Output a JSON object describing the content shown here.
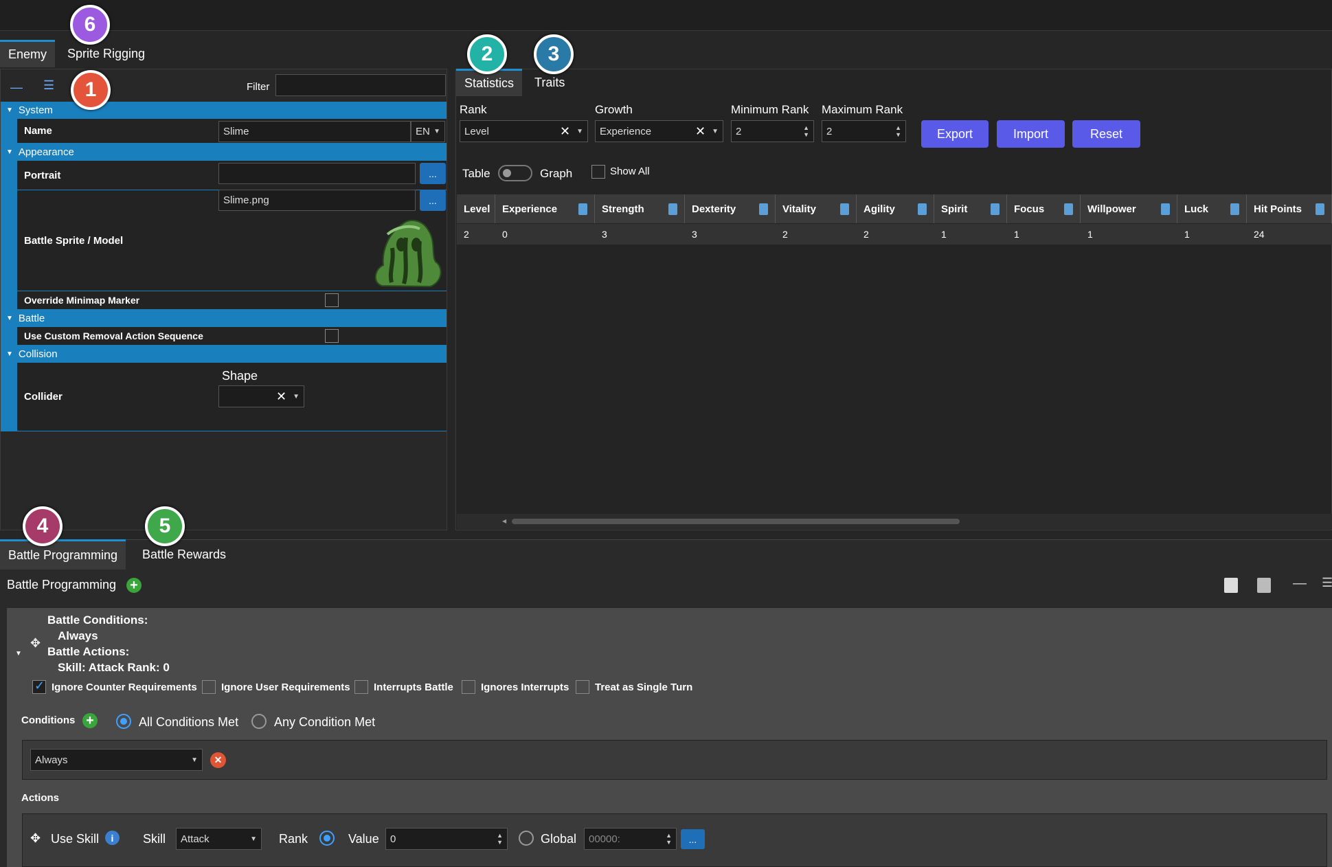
{
  "tabs_left": [
    "Enemy",
    "Sprite Rigging"
  ],
  "tabs_right": [
    "Statistics",
    "Traits"
  ],
  "tabs_bottom": [
    "Battle Programming",
    "Battle Rewards"
  ],
  "badges": [
    "1",
    "2",
    "3",
    "4",
    "5",
    "6"
  ],
  "filter_label": "Filter",
  "sections": {
    "system": "System",
    "appearance": "Appearance",
    "battle": "Battle",
    "collision": "Collision"
  },
  "props": {
    "name_label": "Name",
    "name_value": "Slime",
    "lang": "EN",
    "portrait_label": "Portrait",
    "portrait_value": "",
    "sprite_label": "Battle Sprite / Model",
    "sprite_value": "Slime.png",
    "minimap_label": "Override Minimap Marker",
    "removal_label": "Use Custom Removal Action Sequence",
    "collider_label": "Collider",
    "shape_label": "Shape",
    "dots": "..."
  },
  "stats": {
    "rank_label": "Rank",
    "rank_value": "Level",
    "growth_label": "Growth",
    "growth_value": "Experience",
    "min_rank_label": "Minimum Rank",
    "min_rank_value": "2",
    "max_rank_label": "Maximum Rank",
    "max_rank_value": "2",
    "export": "Export",
    "import": "Import",
    "reset": "Reset",
    "table_label": "Table",
    "graph_label": "Graph",
    "show_all": "Show All",
    "columns": [
      "Level",
      "Experience",
      "Strength",
      "Dexterity",
      "Vitality",
      "Agility",
      "Spirit",
      "Focus",
      "Willpower",
      "Luck",
      "Hit Points"
    ],
    "row": [
      "2",
      "0",
      "3",
      "3",
      "2",
      "2",
      "1",
      "1",
      "1",
      "1",
      "24"
    ]
  },
  "battle": {
    "title": "Battle Programming",
    "cond_header": "Battle Conditions:",
    "cond_value": "Always",
    "act_header": "Battle Actions:",
    "act_value": "Skill: Attack Rank: 0",
    "flags": [
      "Ignore Counter Requirements",
      "Ignore User Requirements",
      "Interrupts Battle",
      "Ignores Interrupts",
      "Treat as Single Turn"
    ],
    "conditions_label": "Conditions",
    "all_met": "All Conditions Met",
    "any_met": "Any Condition Met",
    "condition_value": "Always",
    "actions_label": "Actions",
    "use_skill": "Use Skill",
    "skill_label": "Skill",
    "skill_value": "Attack",
    "rank_label": "Rank",
    "value_label": "Value",
    "value_value": "0",
    "global_label": "Global",
    "global_placeholder": "00000:",
    "dots": "..."
  }
}
